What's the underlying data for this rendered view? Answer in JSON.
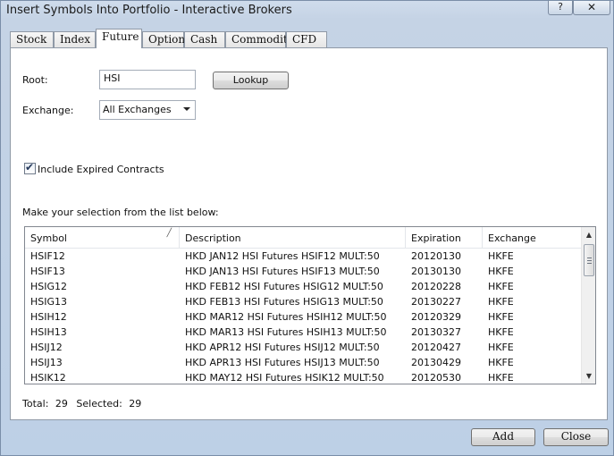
{
  "window": {
    "title": "Insert Symbols Into Portfolio - Interactive Brokers",
    "help_glyph": "?",
    "close_glyph": "✕"
  },
  "tabs": [
    {
      "label": "Stock"
    },
    {
      "label": "Index"
    },
    {
      "label": "Future",
      "active": true
    },
    {
      "label": "Option"
    },
    {
      "label": "Cash"
    },
    {
      "label": "Commodity"
    },
    {
      "label": "CFD"
    }
  ],
  "form": {
    "root_label": "Root:",
    "root_value": "HSI",
    "lookup_label": "Lookup",
    "exchange_label": "Exchange:",
    "exchange_value": "All Exchanges",
    "include_expired_label": "Include Expired Contracts",
    "include_expired_checked": true,
    "selection_prompt": "Make your selection from the list below:"
  },
  "list": {
    "columns": [
      "Symbol",
      "Description",
      "Expiration",
      "Exchange"
    ],
    "rows": [
      [
        "HSIF12",
        "HKD JAN12 HSI Futures HSIF12 MULT:50",
        "20120130",
        "HKFE"
      ],
      [
        "HSIF13",
        "HKD JAN13 HSI Futures HSIF13 MULT:50",
        "20130130",
        "HKFE"
      ],
      [
        "HSIG12",
        "HKD FEB12 HSI Futures HSIG12 MULT:50",
        "20120228",
        "HKFE"
      ],
      [
        "HSIG13",
        "HKD FEB13 HSI Futures HSIG13 MULT:50",
        "20130227",
        "HKFE"
      ],
      [
        "HSIH12",
        "HKD MAR12 HSI Futures HSIH12 MULT:50",
        "20120329",
        "HKFE"
      ],
      [
        "HSIH13",
        "HKD MAR13 HSI Futures HSIH13 MULT:50",
        "20130327",
        "HKFE"
      ],
      [
        "HSIJ12",
        "HKD APR12 HSI Futures HSIJ12 MULT:50",
        "20120427",
        "HKFE"
      ],
      [
        "HSIJ13",
        "HKD APR13 HSI Futures HSIJ13 MULT:50",
        "20130429",
        "HKFE"
      ],
      [
        "HSIK12",
        "HKD MAY12 HSI Futures HSIK12 MULT:50",
        "20120530",
        "HKFE"
      ]
    ]
  },
  "status": {
    "total_label": "Total:",
    "total_value": "29",
    "selected_label": "Selected:",
    "selected_value": "29"
  },
  "buttons": {
    "add_label": "Add",
    "close_label": "Close"
  }
}
